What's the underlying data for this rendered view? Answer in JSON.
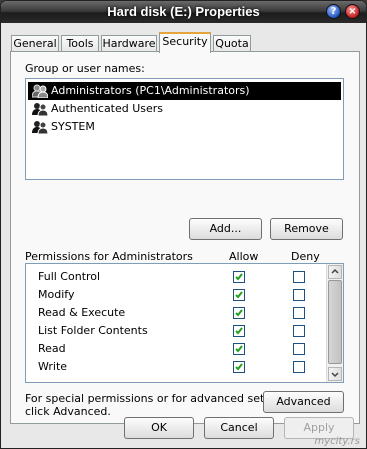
{
  "window": {
    "title": "Hard disk (E:) Properties",
    "help_glyph": "?",
    "close_glyph": "×"
  },
  "tabs": [
    {
      "label": "General"
    },
    {
      "label": "Tools"
    },
    {
      "label": "Hardware"
    },
    {
      "label": "Security",
      "active": true
    },
    {
      "label": "Quota"
    }
  ],
  "security": {
    "group_label": "Group or user names:",
    "users": [
      {
        "name": "Administrators (PC1\\Administrators)",
        "selected": true,
        "icon": "users-group-icon"
      },
      {
        "name": "Authenticated Users",
        "selected": false,
        "icon": "users-group-icon"
      },
      {
        "name": "SYSTEM",
        "selected": false,
        "icon": "users-group-icon"
      }
    ],
    "add_button": "Add...",
    "remove_button": "Remove",
    "permissions_label": "Permissions for Administrators",
    "allow_header": "Allow",
    "deny_header": "Deny",
    "permissions": [
      {
        "name": "Full Control",
        "allow": true,
        "deny": false
      },
      {
        "name": "Modify",
        "allow": true,
        "deny": false
      },
      {
        "name": "Read & Execute",
        "allow": true,
        "deny": false
      },
      {
        "name": "List Folder Contents",
        "allow": true,
        "deny": false
      },
      {
        "name": "Read",
        "allow": true,
        "deny": false
      },
      {
        "name": "Write",
        "allow": true,
        "deny": false
      }
    ],
    "advanced_text_1": "For special permissions or for advanced settings,",
    "advanced_text_2": "click Advanced.",
    "advanced_button": "Advanced"
  },
  "footer": {
    "ok": "OK",
    "cancel": "Cancel",
    "apply": "Apply",
    "watermark": "mycity.rs"
  },
  "colors": {
    "selection": "#000000",
    "check": "#21a121",
    "title_bg": "#2a2a2a"
  }
}
